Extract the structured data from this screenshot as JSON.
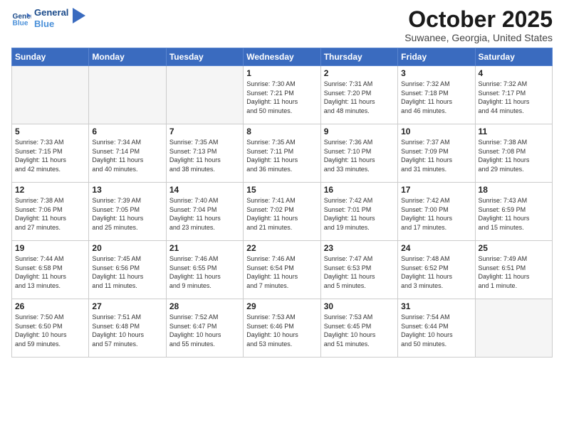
{
  "logo": {
    "line1": "General",
    "line2": "Blue"
  },
  "title": "October 2025",
  "subtitle": "Suwanee, Georgia, United States",
  "days_of_week": [
    "Sunday",
    "Monday",
    "Tuesday",
    "Wednesday",
    "Thursday",
    "Friday",
    "Saturday"
  ],
  "weeks": [
    [
      {
        "day": "",
        "info": ""
      },
      {
        "day": "",
        "info": ""
      },
      {
        "day": "",
        "info": ""
      },
      {
        "day": "1",
        "info": "Sunrise: 7:30 AM\nSunset: 7:21 PM\nDaylight: 11 hours\nand 50 minutes."
      },
      {
        "day": "2",
        "info": "Sunrise: 7:31 AM\nSunset: 7:20 PM\nDaylight: 11 hours\nand 48 minutes."
      },
      {
        "day": "3",
        "info": "Sunrise: 7:32 AM\nSunset: 7:18 PM\nDaylight: 11 hours\nand 46 minutes."
      },
      {
        "day": "4",
        "info": "Sunrise: 7:32 AM\nSunset: 7:17 PM\nDaylight: 11 hours\nand 44 minutes."
      }
    ],
    [
      {
        "day": "5",
        "info": "Sunrise: 7:33 AM\nSunset: 7:15 PM\nDaylight: 11 hours\nand 42 minutes."
      },
      {
        "day": "6",
        "info": "Sunrise: 7:34 AM\nSunset: 7:14 PM\nDaylight: 11 hours\nand 40 minutes."
      },
      {
        "day": "7",
        "info": "Sunrise: 7:35 AM\nSunset: 7:13 PM\nDaylight: 11 hours\nand 38 minutes."
      },
      {
        "day": "8",
        "info": "Sunrise: 7:35 AM\nSunset: 7:11 PM\nDaylight: 11 hours\nand 36 minutes."
      },
      {
        "day": "9",
        "info": "Sunrise: 7:36 AM\nSunset: 7:10 PM\nDaylight: 11 hours\nand 33 minutes."
      },
      {
        "day": "10",
        "info": "Sunrise: 7:37 AM\nSunset: 7:09 PM\nDaylight: 11 hours\nand 31 minutes."
      },
      {
        "day": "11",
        "info": "Sunrise: 7:38 AM\nSunset: 7:08 PM\nDaylight: 11 hours\nand 29 minutes."
      }
    ],
    [
      {
        "day": "12",
        "info": "Sunrise: 7:38 AM\nSunset: 7:06 PM\nDaylight: 11 hours\nand 27 minutes."
      },
      {
        "day": "13",
        "info": "Sunrise: 7:39 AM\nSunset: 7:05 PM\nDaylight: 11 hours\nand 25 minutes."
      },
      {
        "day": "14",
        "info": "Sunrise: 7:40 AM\nSunset: 7:04 PM\nDaylight: 11 hours\nand 23 minutes."
      },
      {
        "day": "15",
        "info": "Sunrise: 7:41 AM\nSunset: 7:02 PM\nDaylight: 11 hours\nand 21 minutes."
      },
      {
        "day": "16",
        "info": "Sunrise: 7:42 AM\nSunset: 7:01 PM\nDaylight: 11 hours\nand 19 minutes."
      },
      {
        "day": "17",
        "info": "Sunrise: 7:42 AM\nSunset: 7:00 PM\nDaylight: 11 hours\nand 17 minutes."
      },
      {
        "day": "18",
        "info": "Sunrise: 7:43 AM\nSunset: 6:59 PM\nDaylight: 11 hours\nand 15 minutes."
      }
    ],
    [
      {
        "day": "19",
        "info": "Sunrise: 7:44 AM\nSunset: 6:58 PM\nDaylight: 11 hours\nand 13 minutes."
      },
      {
        "day": "20",
        "info": "Sunrise: 7:45 AM\nSunset: 6:56 PM\nDaylight: 11 hours\nand 11 minutes."
      },
      {
        "day": "21",
        "info": "Sunrise: 7:46 AM\nSunset: 6:55 PM\nDaylight: 11 hours\nand 9 minutes."
      },
      {
        "day": "22",
        "info": "Sunrise: 7:46 AM\nSunset: 6:54 PM\nDaylight: 11 hours\nand 7 minutes."
      },
      {
        "day": "23",
        "info": "Sunrise: 7:47 AM\nSunset: 6:53 PM\nDaylight: 11 hours\nand 5 minutes."
      },
      {
        "day": "24",
        "info": "Sunrise: 7:48 AM\nSunset: 6:52 PM\nDaylight: 11 hours\nand 3 minutes."
      },
      {
        "day": "25",
        "info": "Sunrise: 7:49 AM\nSunset: 6:51 PM\nDaylight: 11 hours\nand 1 minute."
      }
    ],
    [
      {
        "day": "26",
        "info": "Sunrise: 7:50 AM\nSunset: 6:50 PM\nDaylight: 10 hours\nand 59 minutes."
      },
      {
        "day": "27",
        "info": "Sunrise: 7:51 AM\nSunset: 6:48 PM\nDaylight: 10 hours\nand 57 minutes."
      },
      {
        "day": "28",
        "info": "Sunrise: 7:52 AM\nSunset: 6:47 PM\nDaylight: 10 hours\nand 55 minutes."
      },
      {
        "day": "29",
        "info": "Sunrise: 7:53 AM\nSunset: 6:46 PM\nDaylight: 10 hours\nand 53 minutes."
      },
      {
        "day": "30",
        "info": "Sunrise: 7:53 AM\nSunset: 6:45 PM\nDaylight: 10 hours\nand 51 minutes."
      },
      {
        "day": "31",
        "info": "Sunrise: 7:54 AM\nSunset: 6:44 PM\nDaylight: 10 hours\nand 50 minutes."
      },
      {
        "day": "",
        "info": ""
      }
    ]
  ]
}
